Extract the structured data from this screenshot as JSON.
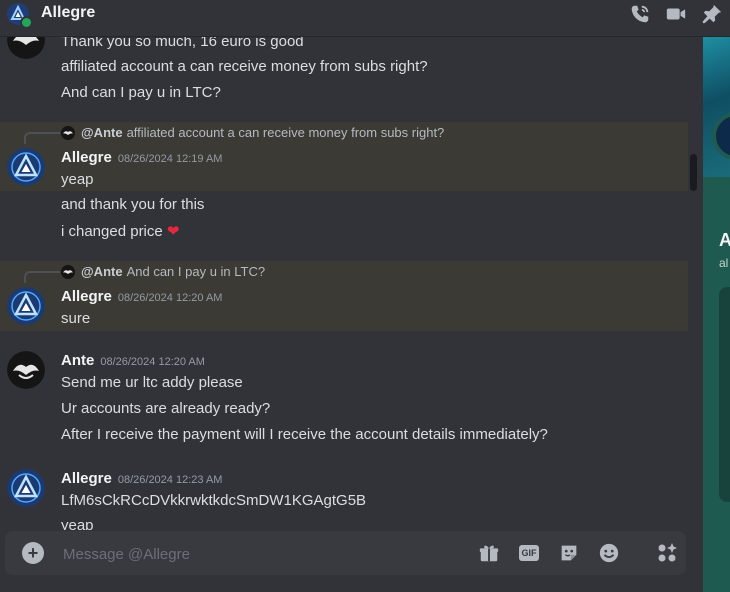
{
  "header": {
    "title": "Allegre",
    "icons": [
      "phone-call-icon",
      "video-camera-icon",
      "pin-icon"
    ]
  },
  "messages": [
    {
      "lines": [
        "Thank you so much, 16 euro is good",
        "affiliated account a can receive money from subs right?",
        "And can I pay u in LTC?"
      ]
    },
    {
      "reply": {
        "mention": "@Ante",
        "text": "affiliated account a can receive money from subs right?"
      },
      "author": "Allegre",
      "timestamp": "08/26/2024 12:19 AM",
      "lines": [
        "yeap",
        "and thank you for this",
        "i changed price"
      ],
      "emoji": "❤"
    },
    {
      "reply": {
        "mention": "@Ante",
        "text": "And can I pay u in LTC?"
      },
      "author": "Allegre",
      "timestamp": "08/26/2024 12:20 AM",
      "lines": [
        "sure"
      ]
    },
    {
      "author": "Ante",
      "timestamp": "08/26/2024 12:20 AM",
      "lines": [
        "Send me ur ltc addy please",
        "Ur accounts are already ready?",
        "After I receive the payment will I receive the account details immediately?"
      ]
    },
    {
      "author": "Allegre",
      "timestamp": "08/26/2024 12:23 AM",
      "lines": [
        "LfM6sCkRCcDVkkrwktkdcSmDW1KGAgtG5B",
        "yeap"
      ]
    }
  ],
  "profile_panel": {
    "name_initial": "A",
    "sub_initial": "al",
    "colors": {
      "panel": "#1e5a50",
      "banner": "#1f8ea3"
    }
  },
  "composer": {
    "placeholder": "Message @Allegre",
    "gif_label": "GIF",
    "icons": [
      "add-icon",
      "gift-icon",
      "gif-icon",
      "sticker-icon",
      "emoji-icon",
      "apps-icon"
    ]
  },
  "colors": {
    "background": "#323339",
    "highlight": "#3b3a35",
    "online": "#23a55a",
    "heart": "#e5283d"
  }
}
